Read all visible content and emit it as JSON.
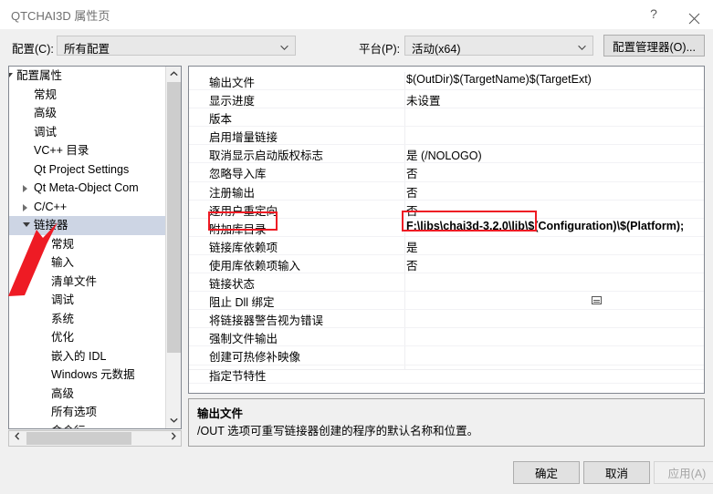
{
  "window": {
    "title": "QTCHAI3D 属性页",
    "help_icon": "?",
    "close_icon": "close-icon"
  },
  "config_bar": {
    "config_label": "配置(C):",
    "config_value": "所有配置",
    "platform_label": "平台(P):",
    "platform_value": "活动(x64)",
    "config_manager_button": "配置管理器(O)..."
  },
  "tree": {
    "items": [
      {
        "label": "配置属性",
        "indent": 8,
        "marker": "open",
        "selected": false
      },
      {
        "label": "常规",
        "indent": 27,
        "marker": "none",
        "selected": false
      },
      {
        "label": "高级",
        "indent": 27,
        "marker": "none",
        "selected": false
      },
      {
        "label": "调试",
        "indent": 27,
        "marker": "none",
        "selected": false
      },
      {
        "label": "VC++ 目录",
        "indent": 27,
        "marker": "none",
        "selected": false
      },
      {
        "label": "Qt Project Settings",
        "indent": 27,
        "marker": "none",
        "selected": false
      },
      {
        "label": "Qt Meta-Object Com",
        "indent": 27,
        "marker": "closed",
        "selected": false
      },
      {
        "label": "C/C++",
        "indent": 27,
        "marker": "closed",
        "selected": false
      },
      {
        "label": "链接器",
        "indent": 27,
        "marker": "open",
        "selected": true
      },
      {
        "label": "常规",
        "indent": 46,
        "marker": "none",
        "selected": false
      },
      {
        "label": "输入",
        "indent": 46,
        "marker": "none",
        "selected": false
      },
      {
        "label": "清单文件",
        "indent": 46,
        "marker": "none",
        "selected": false
      },
      {
        "label": "调试",
        "indent": 46,
        "marker": "none",
        "selected": false
      },
      {
        "label": "系统",
        "indent": 46,
        "marker": "none",
        "selected": false
      },
      {
        "label": "优化",
        "indent": 46,
        "marker": "none",
        "selected": false
      },
      {
        "label": "嵌入的 IDL",
        "indent": 46,
        "marker": "none",
        "selected": false
      },
      {
        "label": "Windows 元数据",
        "indent": 46,
        "marker": "none",
        "selected": false
      },
      {
        "label": "高级",
        "indent": 46,
        "marker": "none",
        "selected": false
      },
      {
        "label": "所有选项",
        "indent": 46,
        "marker": "none",
        "selected": false
      },
      {
        "label": "命令行",
        "indent": 46,
        "marker": "none",
        "selected": false
      }
    ],
    "vscroll_up_icon": "chevron-up-icon",
    "vscroll_down_icon": "chevron-down-icon",
    "hscroll_left_icon": "chevron-left-icon",
    "hscroll_right_icon": "chevron-right-icon"
  },
  "grid": {
    "rows": [
      {
        "name": "输出文件",
        "value": "$(OutDir)$(TargetName)$(TargetExt)",
        "bold": false
      },
      {
        "name": "显示进度",
        "value": "未设置",
        "bold": false
      },
      {
        "name": "版本",
        "value": "",
        "bold": false
      },
      {
        "name": "启用增量链接",
        "value": "",
        "bold": false
      },
      {
        "name": "取消显示启动版权标志",
        "value": "是 (/NOLOGO)",
        "bold": false
      },
      {
        "name": "忽略导入库",
        "value": "否",
        "bold": false
      },
      {
        "name": "注册输出",
        "value": "否",
        "bold": false
      },
      {
        "name": "逐用户重定向",
        "value": "否",
        "bold": false
      },
      {
        "name": "附加库目录",
        "value": "F:\\libs\\chai3d-3.2.0\\lib\\$(Configuration)\\$(Platform);",
        "bold": true
      },
      {
        "name": "链接库依赖项",
        "value": "是",
        "bold": false
      },
      {
        "name": "使用库依赖项输入",
        "value": "否",
        "bold": false
      },
      {
        "name": "链接状态",
        "value": "",
        "bold": false
      },
      {
        "name": "阻止 Dll 绑定",
        "value": "",
        "bold": false
      },
      {
        "name": "将链接器警告视为错误",
        "value": "",
        "bold": false
      },
      {
        "name": "强制文件输出",
        "value": "",
        "bold": false
      },
      {
        "name": "创建可热修补映像",
        "value": "",
        "bold": false
      },
      {
        "name": "指定节特性",
        "value": "",
        "bold": false
      }
    ]
  },
  "description": {
    "title": "输出文件",
    "body": "/OUT 选项可重写链接器创建的程序的默认名称和位置。"
  },
  "footer": {
    "ok": "确定",
    "cancel": "取消",
    "apply": "应用(A)"
  },
  "annotation": {
    "color": "#ee1b24"
  }
}
